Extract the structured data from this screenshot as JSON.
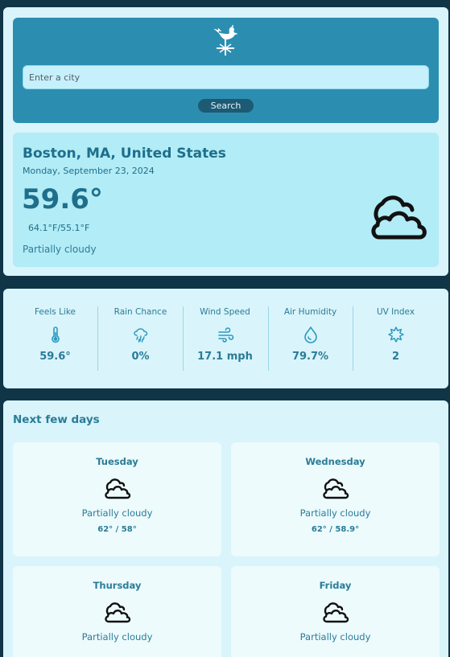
{
  "search": {
    "placeholder": "Enter a city",
    "button_label": "Search",
    "logo_icon": "weathervane-rooster-icon"
  },
  "current": {
    "location": "Boston, MA, United States",
    "date": "Monday, September 23, 2024",
    "temperature": "59.6°",
    "high_low": "64.1°F/55.1°F",
    "condition": "Partially cloudy",
    "icon": "partly-cloudy-icon"
  },
  "metrics": [
    {
      "label": "Feels Like",
      "value": "59.6°",
      "icon": "thermometer-icon"
    },
    {
      "label": "Rain Chance",
      "value": "0%",
      "icon": "cloud-rain-icon"
    },
    {
      "label": "Wind Speed",
      "value": "17.1 mph",
      "icon": "wind-icon"
    },
    {
      "label": "Air Humidity",
      "value": "79.7%",
      "icon": "droplet-icon"
    },
    {
      "label": "UV Index",
      "value": "2",
      "icon": "sun-icon"
    }
  ],
  "forecast": {
    "title": "Next few days",
    "days": [
      {
        "day": "Tuesday",
        "condition": "Partially cloudy",
        "range": "62° / 58°",
        "icon": "partly-cloudy-icon"
      },
      {
        "day": "Wednesday",
        "condition": "Partially cloudy",
        "range": "62° / 58.9°",
        "icon": "partly-cloudy-icon"
      },
      {
        "day": "Thursday",
        "condition": "Partially cloudy",
        "range": "",
        "icon": "partly-cloudy-icon"
      },
      {
        "day": "Friday",
        "condition": "Partially cloudy",
        "range": "",
        "icon": "partly-cloudy-icon"
      }
    ]
  },
  "colors": {
    "accent": "#2a7c98",
    "background": "#0f3547",
    "panel": "#d9f4fa",
    "search_panel": "#2b8eb1"
  }
}
